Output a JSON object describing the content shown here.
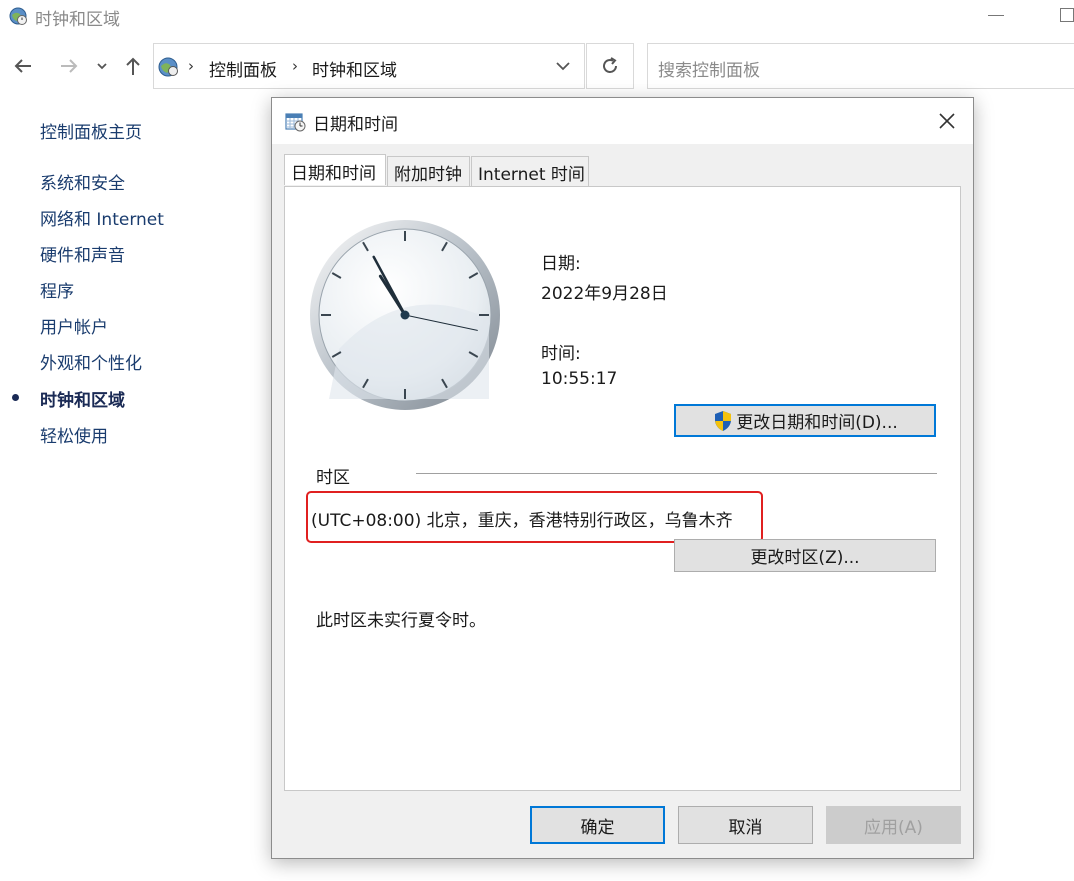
{
  "window": {
    "title": "时钟和区域"
  },
  "nav": {
    "breadcrumb": [
      "控制面板",
      "时钟和区域"
    ],
    "search_placeholder": "搜索控制面板"
  },
  "sidebar": {
    "items": [
      {
        "label": "控制面板主页",
        "active": false
      },
      {
        "label": "系统和安全",
        "active": false
      },
      {
        "label": "网络和 Internet",
        "active": false
      },
      {
        "label": "硬件和声音",
        "active": false
      },
      {
        "label": "程序",
        "active": false
      },
      {
        "label": "用户帐户",
        "active": false
      },
      {
        "label": "外观和个性化",
        "active": false
      },
      {
        "label": "时钟和区域",
        "active": true
      },
      {
        "label": "轻松使用",
        "active": false
      }
    ]
  },
  "dialog": {
    "title": "日期和时间",
    "tabs": [
      "日期和时间",
      "附加时钟",
      "Internet 时间"
    ],
    "date_label": "日期:",
    "date_value": "2022年9月28日",
    "time_label": "时间:",
    "time_value": "10:55:17",
    "change_datetime_button": "更改日期和时间(D)...",
    "timezone_label": "时区",
    "timezone_value": "(UTC+08:00) 北京，重庆，香港特别行政区，乌鲁木齐",
    "change_timezone_button": "更改时区(Z)...",
    "dst_note": "此时区未实行夏令时。",
    "ok_button": "确定",
    "cancel_button": "取消",
    "apply_button": "应用(A)"
  },
  "clock": {
    "hour": 10,
    "minute": 55,
    "second": 17
  },
  "colors": {
    "accent": "#0078d7",
    "highlight": "#e02020",
    "link": "#1a3c6e"
  }
}
